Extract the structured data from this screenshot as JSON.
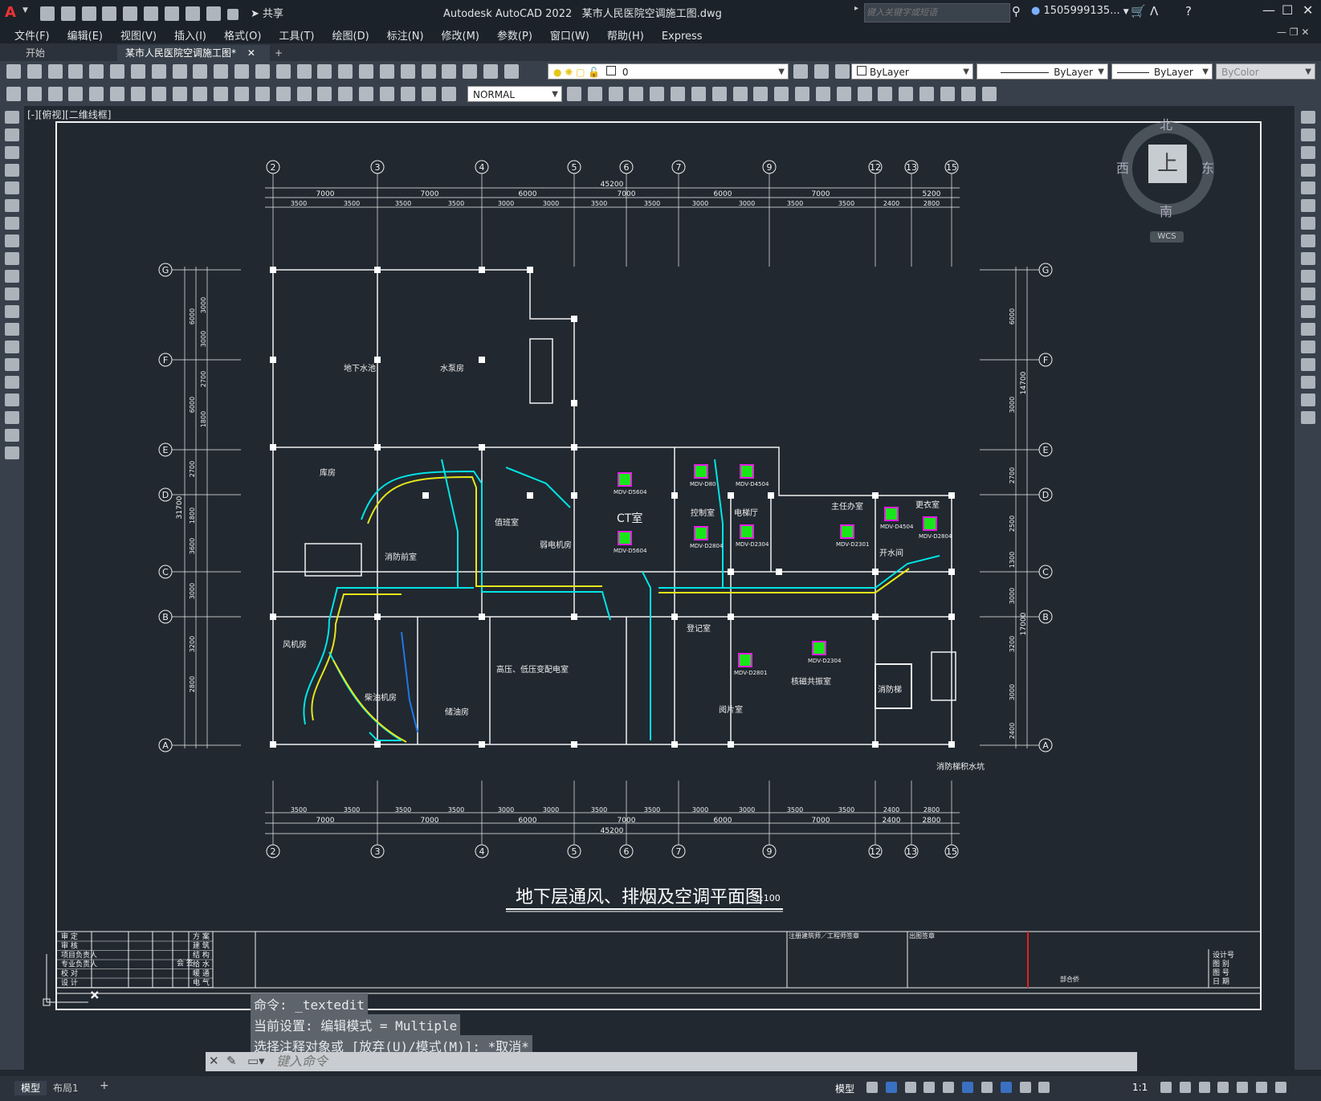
{
  "titlebar": {
    "app_title": "Autodesk AutoCAD 2022",
    "file_name": "某市人民医院空调施工图.dwg",
    "share_label": "共享",
    "search_placeholder": "键入关键字或短语",
    "user_name": "1505999135..."
  },
  "menubar": [
    "文件(F)",
    "编辑(E)",
    "视图(V)",
    "插入(I)",
    "格式(O)",
    "工具(T)",
    "绘图(D)",
    "标注(N)",
    "修改(M)",
    "参数(P)",
    "窗口(W)",
    "帮助(H)",
    "Express"
  ],
  "tabs": {
    "start": "开始",
    "active": "某市人民医院空调施工图*",
    "close": "✕",
    "add": "+"
  },
  "toolbar": {
    "layer_value": "0",
    "style_value": "NORMAL",
    "color_value": "ByLayer",
    "linetype_value": "ByLayer",
    "lineweight_value": "ByLayer",
    "plotstyle_value": "ByColor"
  },
  "viewport_label": "[-][俯视][二维线框]",
  "viewcube": {
    "north": "北",
    "south": "南",
    "east": "东",
    "west": "西",
    "top": "上",
    "wcs": "WCS"
  },
  "drawing": {
    "title": "地下层通风、排烟及空调平面图",
    "scale": "1:100",
    "total_width": "45200",
    "col_axes": [
      "2",
      "3",
      "4",
      "5",
      "6",
      "7",
      "9",
      "12",
      "13",
      "15"
    ],
    "row_axes": [
      "G",
      "F",
      "E",
      "D",
      "C",
      "B",
      "A"
    ],
    "top_spans": [
      "7000",
      "7000",
      "6000",
      "7000",
      "6000",
      "7000",
      "5200"
    ],
    "top_subspans": [
      "3500",
      "3500",
      "3500",
      "3500",
      "3000",
      "3000",
      "3500",
      "3500",
      "3000",
      "3000",
      "3500",
      "3500",
      "2400",
      "2800"
    ],
    "bottom_spans": [
      "7000",
      "7000",
      "6000",
      "7000",
      "6000",
      "7000",
      "2400",
      "2800"
    ],
    "left_dims": [
      "6000",
      "6000",
      "2700",
      "1800",
      "3600",
      "3000",
      "3200",
      "2800",
      "3000",
      "3000",
      "2700",
      "1800"
    ],
    "left_total": "31700",
    "right_dims": [
      "6000",
      "3000",
      "2700",
      "2500",
      "1300",
      "3000",
      "3200",
      "3000",
      "2400"
    ],
    "right_totals": [
      "14700",
      "17000"
    ],
    "room_labels": [
      "地下水池",
      "水泵房",
      "库房",
      "消防前室",
      "值班室",
      "弱电机房",
      "高压、低压变配电室",
      "柴油机房",
      "储油房",
      "风机房",
      "CT室",
      "控制室",
      "电梯厅",
      "登记室",
      "核磁共振室",
      "阅片室",
      "主任办室",
      "开水间",
      "更衣室",
      "消防梯",
      "消防梯积水坑"
    ],
    "equipment_tags": [
      "MDV-D5604",
      "MDV-D5604",
      "MDV-D80",
      "MDV-D2804",
      "MDV-D2304",
      "MDV-D4504",
      "MDV-D4504",
      "MDV-D2304",
      "MDV-D2801",
      "MDV-D2804",
      "MDV-D2301"
    ]
  },
  "titleblock": {
    "left_rows": [
      "审 定",
      "审 核",
      "项目负责人",
      "专业负责人",
      "校 对",
      "设 计"
    ],
    "mid_rows": [
      "方 案",
      "建 筑",
      "结 构",
      "给 水",
      "暖 通",
      "电 气"
    ],
    "center_labels": [
      "注册建筑师／工程师签章",
      "出图签章"
    ],
    "right_rows": [
      "设计号",
      "图 别",
      "图 号",
      "日 期"
    ],
    "sign_label": "会 签",
    "part_label": "部合侨"
  },
  "command": {
    "history": [
      "命令:  _textedit",
      "当前设置: 编辑模式 = Multiple",
      "选择注释对象或 [放弃(U)/模式(M)]: *取消*"
    ],
    "placeholder": "键入命令"
  },
  "statusbar": {
    "model_tab": "模型",
    "layout_tab": "布局1",
    "mode_label": "模型",
    "scale_label": "1:1"
  },
  "colors": {
    "accent": "#c41e1e",
    "duct_green": "#19e619",
    "duct_cyan": "#00e5e5",
    "duct_yellow": "#e6e619",
    "canvas": "#212830"
  }
}
